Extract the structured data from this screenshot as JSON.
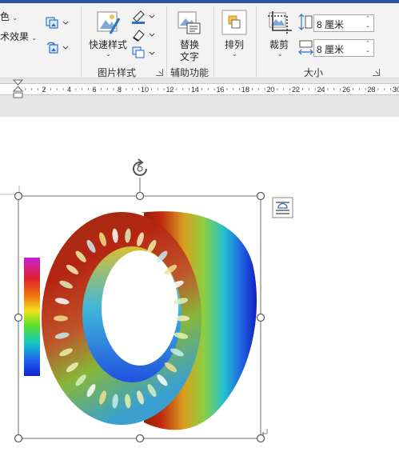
{
  "ribbon": {
    "color_label": "色",
    "art_effect_label": "术效果",
    "quick_style_label": "快速样式",
    "group_picture_style": "图片样式",
    "alt_text_label_1": "替换",
    "alt_text_label_2": "文字",
    "group_accessibility": "辅助功能",
    "arrange_label": "排列",
    "crop_label": "裁剪",
    "group_size": "大小",
    "height_value": "8 厘米",
    "width_value": "8 厘米"
  },
  "ruler": {
    "ticks": [
      "2",
      "4",
      "6",
      "8",
      "10",
      "12",
      "14",
      "16",
      "18",
      "20",
      "22",
      "24",
      "26",
      "28",
      "30"
    ]
  },
  "colors": {
    "ribbon_bg": "#f3f3f3",
    "title_bar": "#2b579a",
    "ruler_bg": "#e6e6e6",
    "accent_blue": "#2b73c9",
    "handle": "#555555"
  },
  "icons": [
    "shape-fill-icon",
    "shape-outline-icon",
    "shape-effects-icon",
    "change-picture-icon",
    "reset-picture-icon",
    "quick-styles-icon",
    "alt-text-icon",
    "arrange-icon",
    "crop-icon",
    "height-icon",
    "width-icon",
    "rotate-handle-icon",
    "layout-options-icon",
    "paragraph-mark-icon"
  ]
}
